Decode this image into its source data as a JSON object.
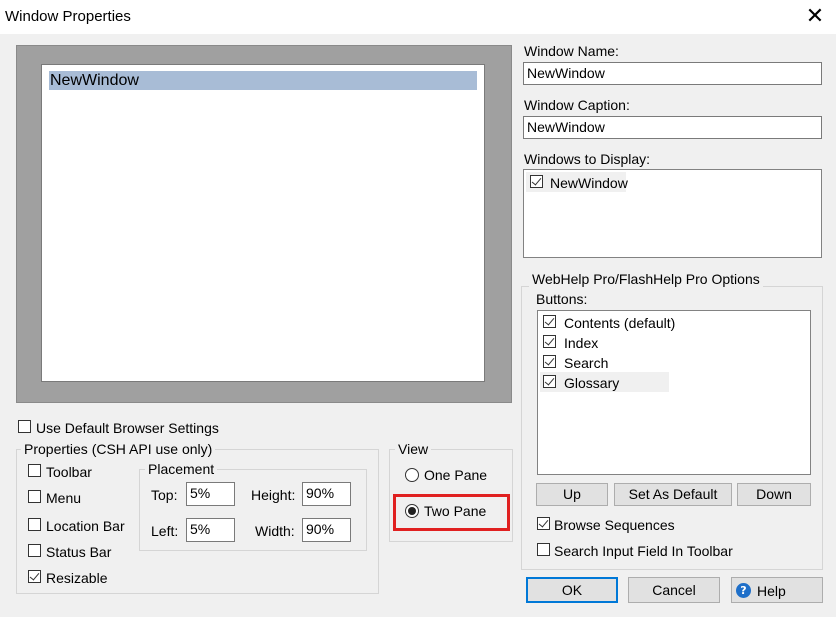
{
  "window": {
    "title": "Window Properties",
    "close_glyph": "✕"
  },
  "preview": {
    "window_label": "NewWindow"
  },
  "window_name": {
    "label": "Window Name:",
    "value": "NewWindow"
  },
  "window_caption": {
    "label": "Window Caption:",
    "value": "NewWindow"
  },
  "windows_to_display": {
    "label": "Windows to Display:",
    "items": [
      {
        "label": "NewWindow",
        "checked": true
      }
    ]
  },
  "use_default_browser": {
    "label": "Use Default Browser Settings",
    "checked": false
  },
  "properties": {
    "title": "Properties (CSH API use only)",
    "toolbar": {
      "label": "Toolbar",
      "checked": false
    },
    "menu": {
      "label": "Menu",
      "checked": false
    },
    "location_bar": {
      "label": "Location Bar",
      "checked": false
    },
    "status_bar": {
      "label": "Status Bar",
      "checked": false
    },
    "resizable": {
      "label": "Resizable",
      "checked": true
    },
    "placement": {
      "title": "Placement",
      "top_label": "Top:",
      "top_value": "5%",
      "height_label": "Height:",
      "height_value": "90%",
      "left_label": "Left:",
      "left_value": "5%",
      "width_label": "Width:",
      "width_value": "90%"
    }
  },
  "view": {
    "title": "View",
    "one_pane": {
      "label": "One Pane",
      "selected": false
    },
    "two_pane": {
      "label": "Two Pane",
      "selected": true
    }
  },
  "webhelp": {
    "title": "WebHelp Pro/FlashHelp Pro Options",
    "buttons_label": "Buttons:",
    "items": [
      {
        "label": "Contents (default)",
        "checked": true
      },
      {
        "label": "Index",
        "checked": true
      },
      {
        "label": "Search",
        "checked": true
      },
      {
        "label": "Glossary",
        "checked": true
      }
    ],
    "up_label": "Up",
    "set_default_label": "Set As Default",
    "down_label": "Down",
    "browse_sequences": {
      "label": "Browse Sequences",
      "checked": true
    },
    "search_input": {
      "label": "Search Input Field In Toolbar",
      "checked": false
    }
  },
  "footer": {
    "ok_label": "OK",
    "cancel_label": "Cancel",
    "help_label": "Help",
    "help_icon_glyph": "?"
  },
  "colors": {
    "highlight": "#e02020",
    "selection": "#a8bcd6",
    "default_button_border": "#0078d7",
    "help_icon": "#1e6fc9"
  }
}
